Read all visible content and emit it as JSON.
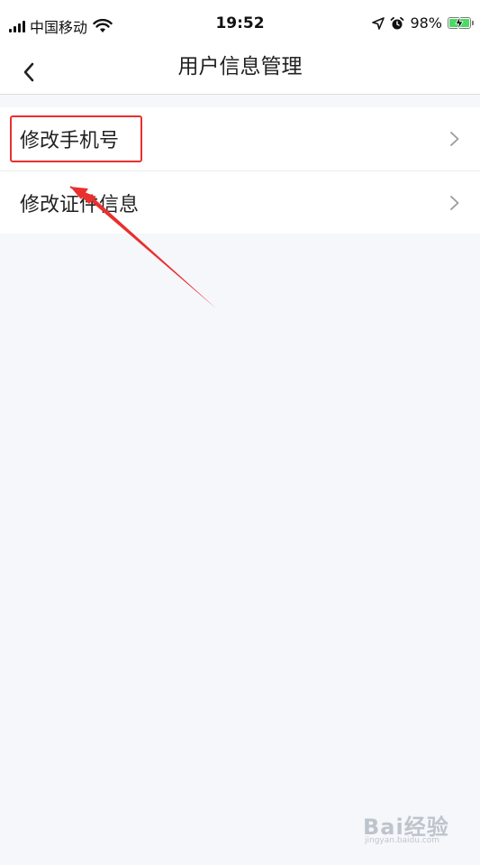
{
  "status_bar": {
    "carrier": "中国移动",
    "time": "19:52",
    "battery": "98%",
    "battery_level": 0.98,
    "icons": [
      "signal-icon",
      "wifi-icon",
      "location-icon",
      "alarm-icon",
      "battery-icon"
    ]
  },
  "nav": {
    "title": "用户信息管理",
    "back_icon": "chevron-left-icon"
  },
  "list": {
    "items": [
      {
        "label": "修改手机号"
      },
      {
        "label": "修改证件信息"
      }
    ]
  },
  "annotation": {
    "color": "#e8302f"
  },
  "watermark": {
    "text": "Bai经验",
    "subtext": "jingyan.baidu.com"
  }
}
